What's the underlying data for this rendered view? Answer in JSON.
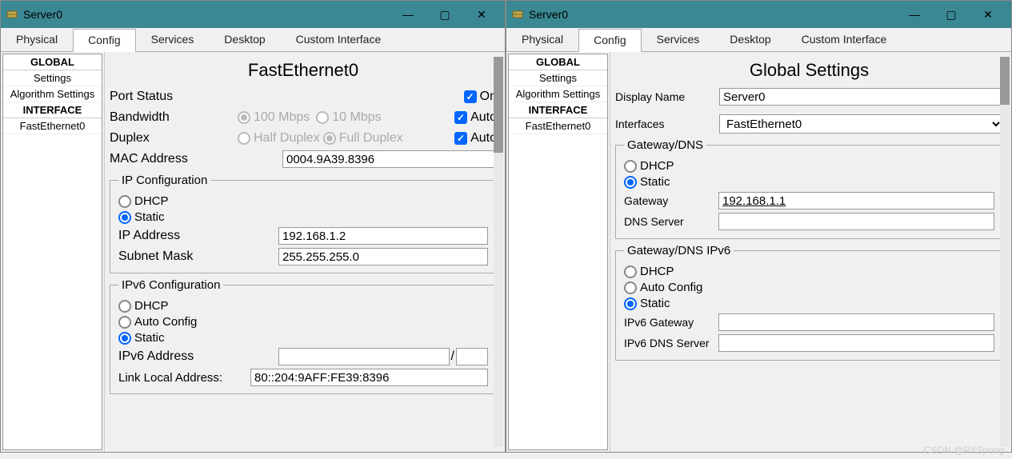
{
  "left": {
    "title": "Server0",
    "tabs": {
      "physical": "Physical",
      "config": "Config",
      "services": "Services",
      "desktop": "Desktop",
      "custom": "Custom Interface"
    },
    "sidebar": {
      "global": "GLOBAL",
      "settings": "Settings",
      "algo": "Algorithm Settings",
      "interface": "INTERFACE",
      "iface0": "FastEthernet0"
    },
    "panel": {
      "title": "FastEthernet0",
      "portStatus": "Port Status",
      "on": "On",
      "bandwidth": "Bandwidth",
      "bw100": "100 Mbps",
      "bw10": "10 Mbps",
      "auto": "Auto",
      "duplex": "Duplex",
      "half": "Half Duplex",
      "full": "Full Duplex",
      "mac": "MAC Address",
      "macVal": "0004.9A39.8396",
      "ipconfig": "IP Configuration",
      "dhcp": "DHCP",
      "static": "Static",
      "ipaddr": "IP Address",
      "ipaddrVal": "192.168.1.2",
      "mask": "Subnet Mask",
      "maskVal": "255.255.255.0",
      "ipv6config": "IPv6 Configuration",
      "autoConfig": "Auto Config",
      "ipv6addr": "IPv6 Address",
      "ipv6addrVal": "",
      "prefix": "",
      "slash": "/",
      "linkLocal": "Link Local Address:",
      "linkLocalVal": "80::204:9AFF:FE39:8396"
    }
  },
  "right": {
    "title": "Server0",
    "tabs": {
      "physical": "Physical",
      "config": "Config",
      "services": "Services",
      "desktop": "Desktop",
      "custom": "Custom Interface"
    },
    "sidebar": {
      "global": "GLOBAL",
      "settings": "Settings",
      "algo": "Algorithm Settings",
      "interface": "INTERFACE",
      "iface0": "FastEthernet0"
    },
    "panel": {
      "title": "Global Settings",
      "display": "Display Name",
      "displayVal": "Server0",
      "ifaces": "Interfaces",
      "ifacesVal": "FastEthernet0",
      "gwDns": "Gateway/DNS",
      "dhcp": "DHCP",
      "static": "Static",
      "gateway": "Gateway",
      "gatewayVal": "192.168.1.1",
      "dns": "DNS Server",
      "dnsVal": "",
      "gwDns6": "Gateway/DNS IPv6",
      "autoConfig": "Auto Config",
      "ipv6gw": "IPv6 Gateway",
      "ipv6gwVal": "",
      "ipv6dns": "IPv6 DNS Server",
      "ipv6dnsVal": ""
    }
  },
  "watermark": "CSDN @PYSpring"
}
